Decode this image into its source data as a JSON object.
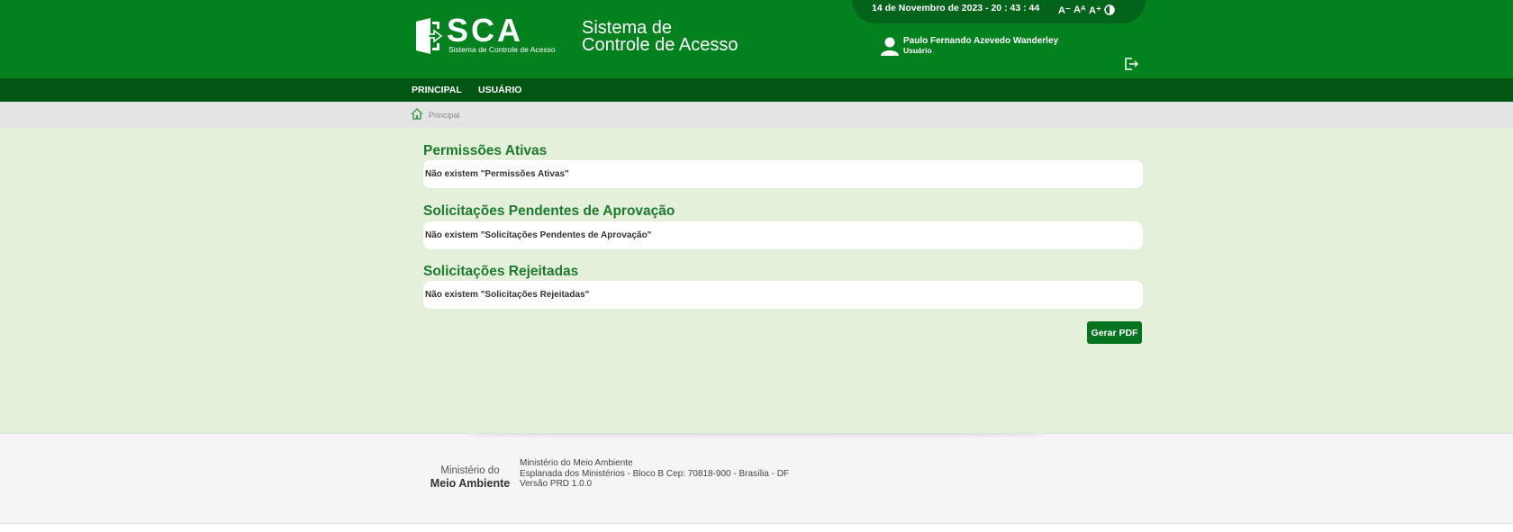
{
  "header": {
    "logo_text": "SCA",
    "logo_subtitle": "Sistema de Controle de Acesso",
    "system_title_line1": "Sistema de",
    "system_title_line2": "Controle de Acesso",
    "datetime": "14 de Novembro de 2023 - 20 : 43 : 44",
    "font_decrease": "A⁻",
    "font_default": "Aᴬ",
    "font_increase": "A⁺",
    "user_name": "Paulo Fernando Azevedo Wanderley",
    "user_role": "Usuário",
    "icons": [
      "door-logo-icon",
      "contrast-icon",
      "user-icon",
      "logout-icon"
    ]
  },
  "nav": {
    "items": [
      {
        "label": "PRINCIPAL"
      },
      {
        "label": "USUÁRIO"
      }
    ]
  },
  "breadcrumb": {
    "home_label": "Principal",
    "icon": "home-icon"
  },
  "sections": [
    {
      "title": "Permissões Ativas",
      "message": "Não existem \"Permissões Ativas\""
    },
    {
      "title": "Solicitações Pendentes de Aprovação",
      "message": "Não existem \"Solicitações Pendentes de Aprovação\""
    },
    {
      "title": "Solicitações Rejeitadas",
      "message": "Não existem \"Solicitações Rejeitadas\""
    }
  ],
  "actions": {
    "pdf_label": "Gerar PDF"
  },
  "footer": {
    "logo_line1": "Ministério do",
    "logo_line2": "Meio Ambiente",
    "info_line1": "Ministério do Meio Ambiente",
    "info_line2": "Esplanada dos Ministérios - Bloco B Cep: 70818-900 - Brasília - DF",
    "info_line3": "Versão PRD 1.0.0"
  },
  "colors": {
    "header_green": "#03811f",
    "nav_green": "#015614",
    "title_green": "#1d7a2e",
    "content_background": "#e4f0da",
    "button_green": "#02731f"
  }
}
